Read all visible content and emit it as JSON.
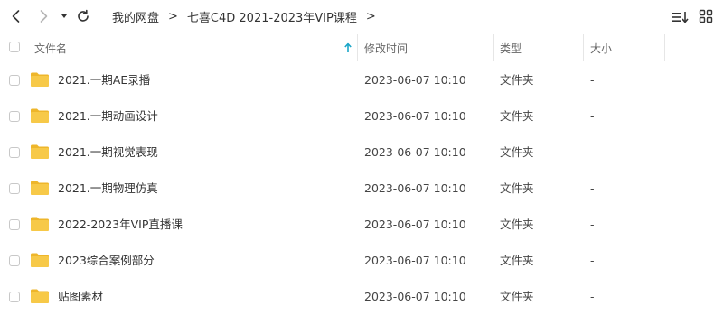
{
  "nav": {
    "back_icon": "chevron-left-icon",
    "forward_icon": "chevron-right-icon",
    "dropdown_icon": "caret-down-icon",
    "refresh_icon": "refresh-icon",
    "sort_icon": "sort-list-icon",
    "grid_icon": "grid-view-icon"
  },
  "breadcrumb": {
    "items": [
      "我的网盘",
      "七喜C4D 2021-2023年VIP课程"
    ],
    "separator": ">"
  },
  "columns": {
    "name": "文件名",
    "modified": "修改时间",
    "type": "类型",
    "size": "大小"
  },
  "files": [
    {
      "name": "2021.一期AE录播",
      "modified": "2023-06-07 10:10",
      "type": "文件夹",
      "size": "-"
    },
    {
      "name": "2021.一期动画设计",
      "modified": "2023-06-07 10:10",
      "type": "文件夹",
      "size": "-"
    },
    {
      "name": "2021.一期视觉表现",
      "modified": "2023-06-07 10:10",
      "type": "文件夹",
      "size": "-"
    },
    {
      "name": "2021.一期物理仿真",
      "modified": "2023-06-07 10:10",
      "type": "文件夹",
      "size": "-"
    },
    {
      "name": "2022-2023年VIP直播课",
      "modified": "2023-06-07 10:10",
      "type": "文件夹",
      "size": "-"
    },
    {
      "name": "2023综合案例部分",
      "modified": "2023-06-07 10:10",
      "type": "文件夹",
      "size": "-"
    },
    {
      "name": "贴图素材",
      "modified": "2023-06-07 10:10",
      "type": "文件夹",
      "size": "-"
    }
  ],
  "colors": {
    "folder": "#f7c948",
    "folder_dark": "#eeb62b",
    "sort_arrow": "#1aa6c8"
  }
}
